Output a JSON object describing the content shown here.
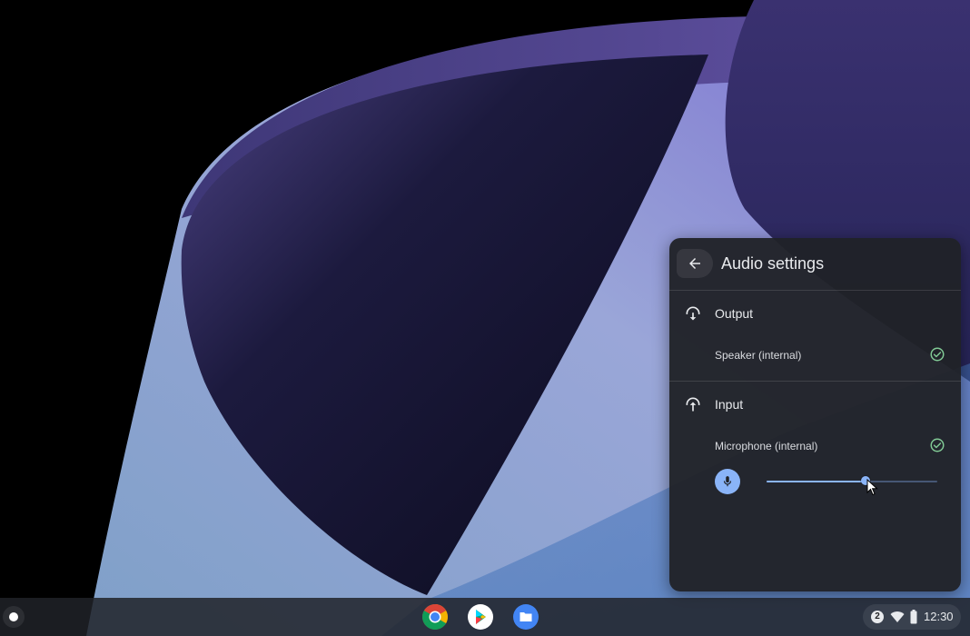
{
  "colors": {
    "accent": "#8ab4f8",
    "success_check": "#81c995",
    "panel_bg": "#202228",
    "text_primary": "#e8eaed"
  },
  "audio_settings": {
    "title": "Audio settings",
    "back_icon": "arrow-back-icon",
    "output": {
      "label": "Output",
      "icon": "speaker-icon",
      "devices": [
        {
          "label": "Speaker (internal)",
          "selected": true
        }
      ]
    },
    "input": {
      "label": "Input",
      "icon": "microphone-section-icon",
      "devices": [
        {
          "label": "Microphone (internal)",
          "selected": true
        }
      ],
      "gain_percent": 58,
      "mic_icon": "microphone-icon"
    }
  },
  "shelf": {
    "launcher_icon": "launcher-icon",
    "apps": [
      {
        "name": "Chrome",
        "icon": "chrome-icon"
      },
      {
        "name": "Play Store",
        "icon": "play-store-icon"
      },
      {
        "name": "Files",
        "icon": "files-icon"
      }
    ],
    "status": {
      "notification_count": "2",
      "time": "12:30"
    }
  }
}
